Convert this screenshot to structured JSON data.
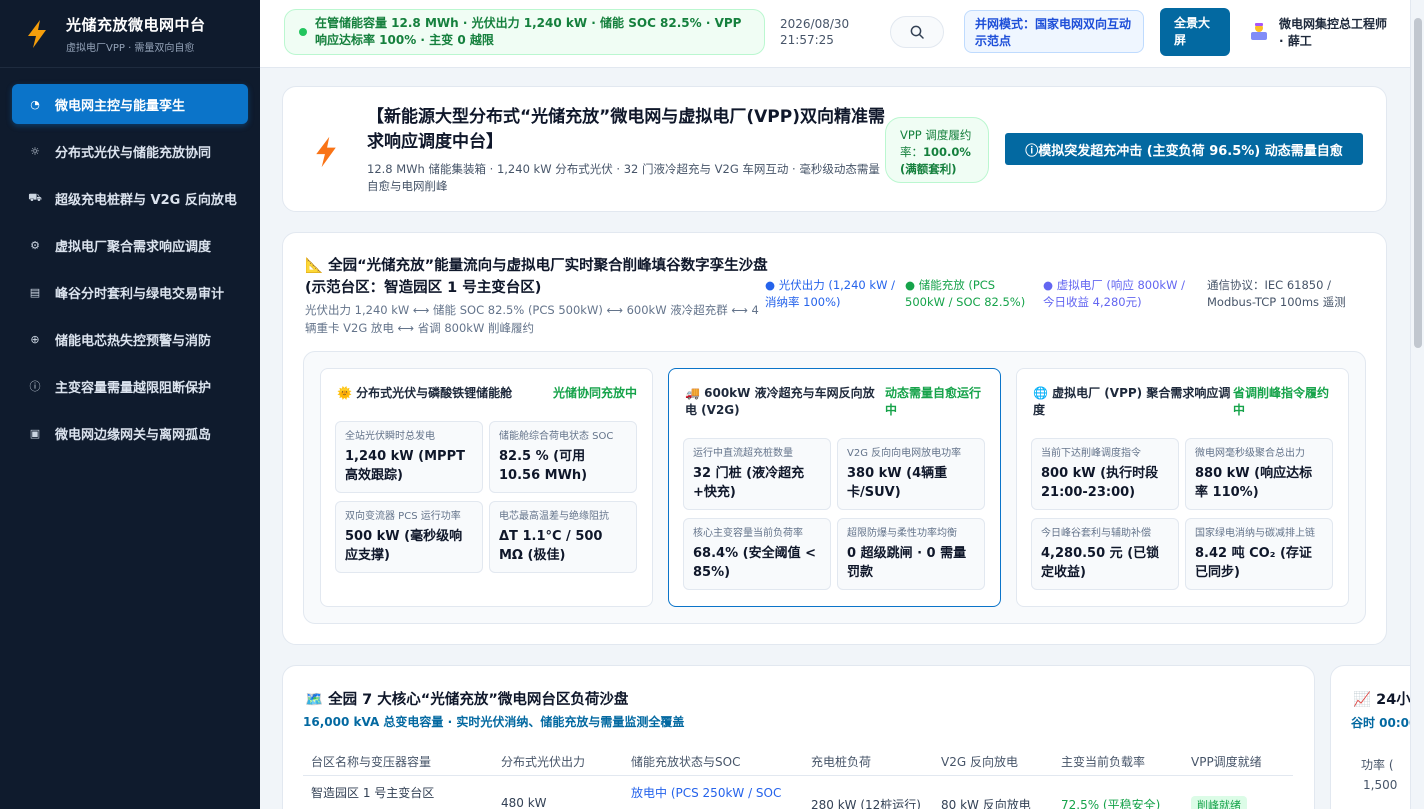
{
  "brand": {
    "title": "光储充放微电网中台",
    "subtitle": "虚拟电厂VPP · 需量双向自愈"
  },
  "nav": [
    {
      "label": "微电网主控与能量孪生",
      "icon": "activity-icon"
    },
    {
      "label": "分布式光伏与储能充放协同",
      "icon": "sun-icon"
    },
    {
      "label": "超级充电桩群与 V2G 反向放电",
      "icon": "truck-icon"
    },
    {
      "label": "虚拟电厂聚合需求响应调度",
      "icon": "cpu-icon"
    },
    {
      "label": "峰谷分时套利与绿电交易审计",
      "icon": "receipt-icon"
    },
    {
      "label": "储能电芯热失控预警与消防",
      "icon": "crosshair-icon"
    },
    {
      "label": "主变容量需量越限阻断保护",
      "icon": "alert-circle-icon"
    },
    {
      "label": "微电网边缘网关与离网孤岛",
      "icon": "chip-icon"
    }
  ],
  "topbar": {
    "status": "在管储能容量 12.8 MWh · 光伏出力 1,240 kW · 储能 SOC 82.5% · VPP 响应达标率 100% · 主变 0 越限",
    "date": "2026/08/30",
    "time": "21:57:25",
    "grid_mode": "并网模式：国家电网双向互动示范点",
    "fullscreen": "全景大屏",
    "user": "微电网集控总工程师 · 薛工"
  },
  "hero": {
    "title": "【新能源大型分布式“光储充放”微电网与虚拟电厂(VPP)双向精准需求响应调度中台】",
    "subtitle": "12.8 MWh 储能集装箱 · 1,240 kW 分布式光伏 · 32 门液冷超充与 V2G 车网互动 · 毫秒级动态需量自愈与电网削峰",
    "vpp_label": "VPP 调度履约率：",
    "vpp_value": "100.0% (满额套利)",
    "simulate_button": "ⓘ模拟突发超充冲击 (主变负荷 96.5%) 动态需量自愈"
  },
  "twin": {
    "title": "全园“光储充放”能量流向与虚拟电厂实时聚合削峰填谷数字孪生沙盘 (示范台区：智造园区 1 号主变台区)",
    "subtitle": "光伏出力 1,240 kW ⟷ 储能 SOC 82.5% (PCS 500kW) ⟷ 600kW 液冷超充群 ⟷ 4 辆重卡 V2G 放电 ⟷ 省调 800kW 削峰履约",
    "legend": [
      "● 光伏出力 (1,240 kW / 消纳率 100%)",
      "● 储能充放 (PCS 500kW / SOC 82.5%)",
      "● 虚拟电厂 (响应 800kW / 今日收益 4,280元)",
      "通信协议：IEC 61850 / Modbus-TCP 100ms 遥测"
    ],
    "panels": [
      {
        "title": "分布式光伏与磷酸铁锂储能舱",
        "status": "光储协同充放中",
        "metrics": [
          {
            "label": "全站光伏瞬时总发电",
            "value": "1,240 kW (MPPT 高效跟踪)"
          },
          {
            "label": "储能舱综合荷电状态 SOC",
            "value": "82.5 % (可用 10.56 MWh)"
          },
          {
            "label": "双向变流器 PCS 运行功率",
            "value": "500 kW (毫秒级响应支撑)"
          },
          {
            "label": "电芯最高温差与绝缘阻抗",
            "value": "ΔT 1.1°C / 500 MΩ (极佳)"
          }
        ]
      },
      {
        "title": "600kW 液冷超充与车网反向放电 (V2G)",
        "status": "动态需量自愈运行中",
        "metrics": [
          {
            "label": "运行中直流超充桩数量",
            "value": "32 门桩 (液冷超充+快充)"
          },
          {
            "label": "V2G 反向向电网放电功率",
            "value": "380 kW (4辆重卡/SUV)"
          },
          {
            "label": "核心主变容量当前负荷率",
            "value": "68.4% (安全阈值 < 85%)"
          },
          {
            "label": "超限防爆与柔性功率均衡",
            "value": "0 超级跳闸 · 0 需量罚款"
          }
        ]
      },
      {
        "title": "虚拟电厂 (VPP) 聚合需求响应调度",
        "status": "省调削峰指令履约中",
        "metrics": [
          {
            "label": "当前下达削峰调度指令",
            "value": "800 kW (执行时段 21:00-23:00)"
          },
          {
            "label": "微电网毫秒级聚合总出力",
            "value": "880 kW (响应达标率 110%)"
          },
          {
            "label": "今日峰谷套利与辅助补偿",
            "value": "4,280.50 元 (已锁定收益)"
          },
          {
            "label": "国家绿电消纳与碳减排上链",
            "value": "8.42 吨 CO₂ (存证已同步)"
          }
        ]
      }
    ]
  },
  "zones": {
    "title": "全园 7 大核心“光储充放”微电网台区负荷沙盘",
    "subtitle": "16,000 kVA 总变电容量 · 实时光伏消纳、储能充放与需量监测全覆盖",
    "headers": [
      "台区名称与变压器容量",
      "分布式光伏出力",
      "储能充放状态与SOC",
      "充电桩负荷",
      "V2G 反向放电",
      "主变当前负载率",
      "VPP调度就绪"
    ],
    "row": [
      "智造园区 1 号主变台区",
      "480 kW",
      "放电中 (PCS 250kW / SOC",
      "280 kW (12桩运行)",
      "80 kW 反向放电",
      "72.5% (平稳安全)",
      "削峰就绪"
    ]
  },
  "trend": {
    "title": "📈 24小",
    "subtitle": "谷时 00:00",
    "ylabel": "功率 (",
    "tick": "1,500"
  }
}
